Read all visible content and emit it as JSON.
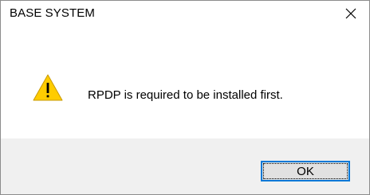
{
  "window": {
    "title": "BASE SYSTEM",
    "close_icon": "close-icon"
  },
  "content": {
    "icon": "warning-icon",
    "message": "RPDP is required to be installed first."
  },
  "footer": {
    "ok_label": "OK"
  },
  "colors": {
    "warning_fill": "#ffcc00",
    "accent": "#0078d7",
    "footer_bg": "#f0f0f0"
  }
}
